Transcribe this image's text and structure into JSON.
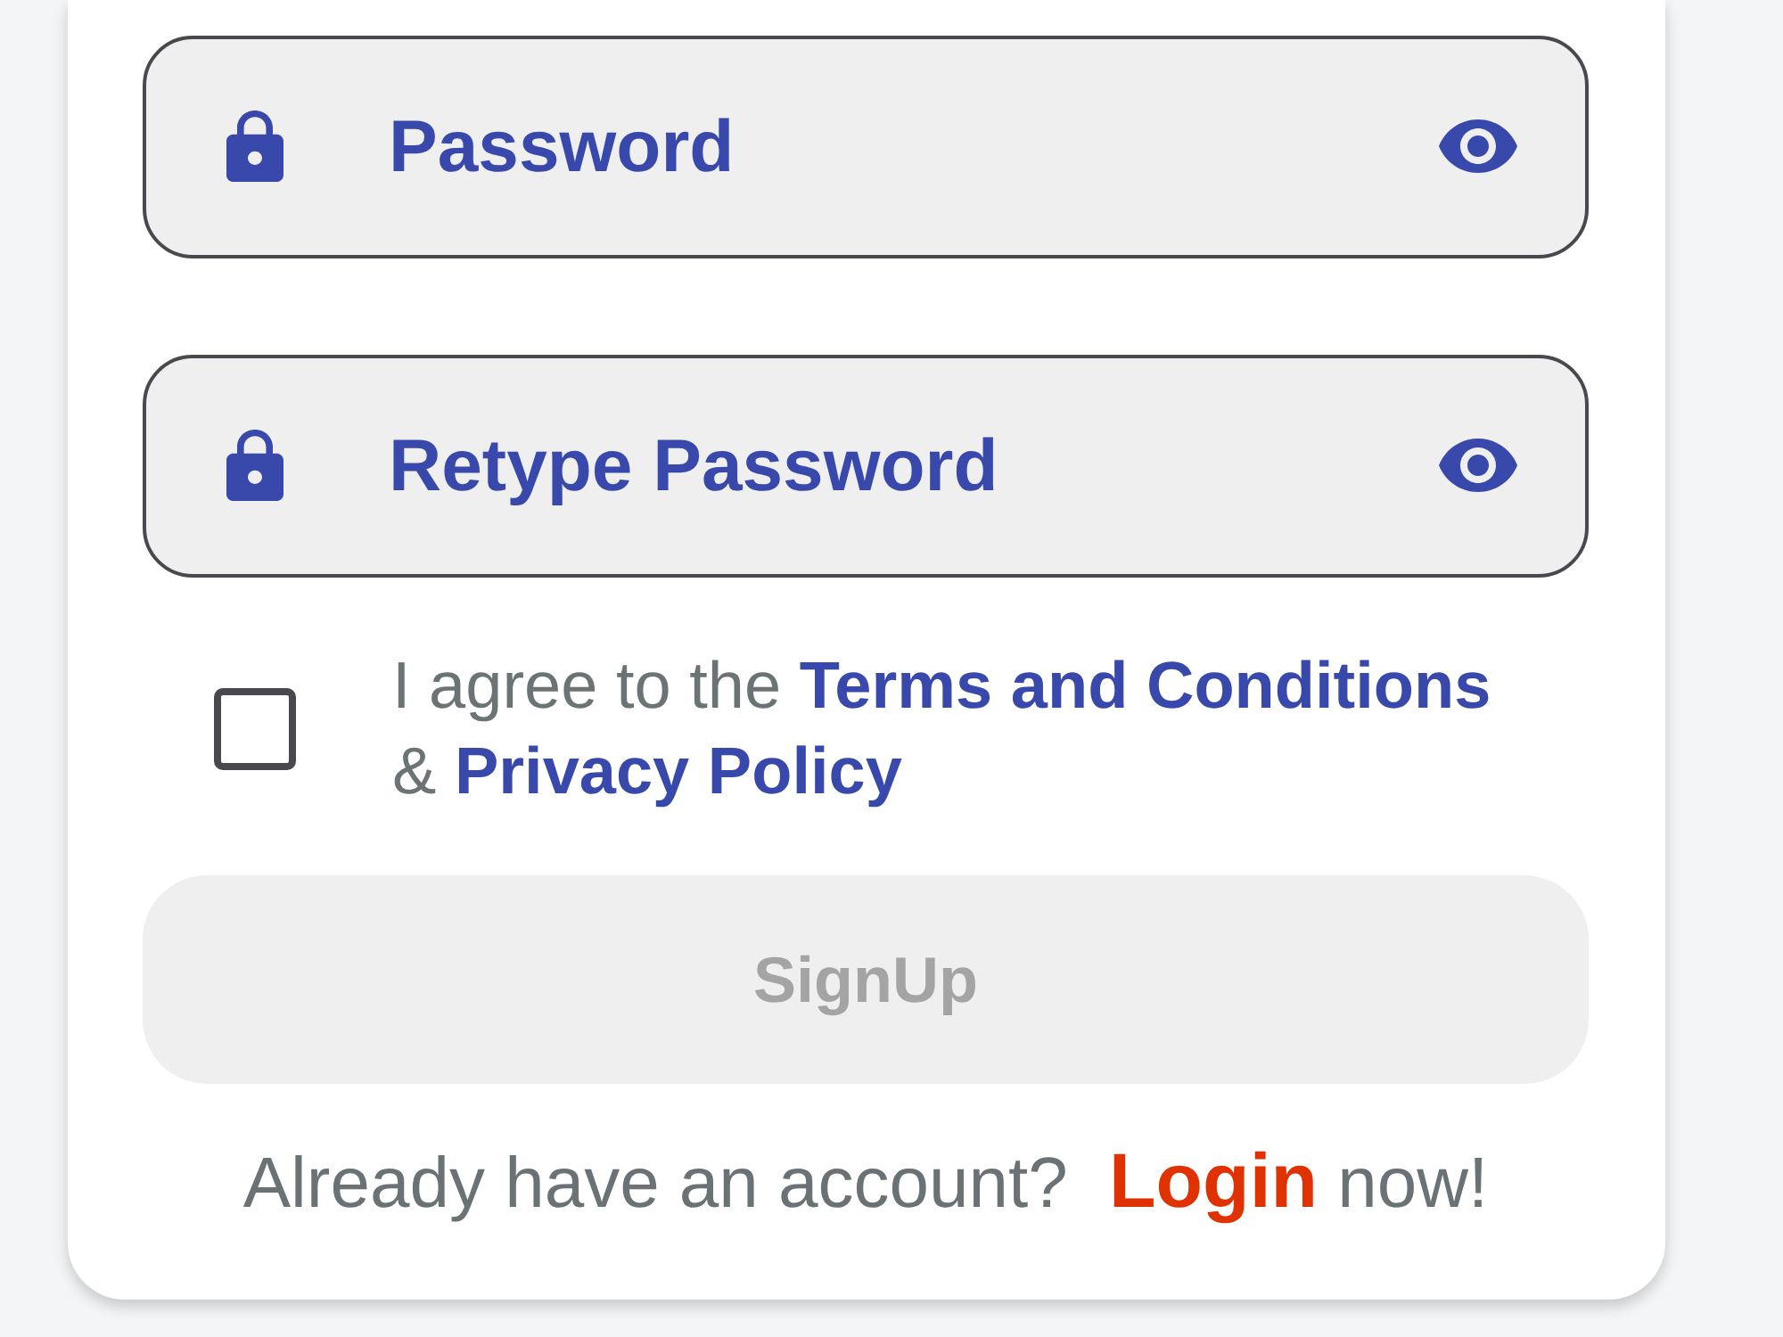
{
  "fields": [
    {
      "placeholder": "Password"
    },
    {
      "placeholder": "Retype Password"
    }
  ],
  "agreement": {
    "checked": false,
    "parts": [
      {
        "kind": "text",
        "text": "I agree to the"
      },
      {
        "kind": "link",
        "text": "Terms and Conditions"
      },
      {
        "kind": "text",
        "text": "&"
      },
      {
        "kind": "link",
        "text": "Privacy Policy"
      }
    ]
  },
  "signup_button": {
    "label": "SignUp",
    "disabled": true
  },
  "footer": {
    "prompt": "Already have an account?",
    "link": "Login",
    "suffix": "now!"
  }
}
